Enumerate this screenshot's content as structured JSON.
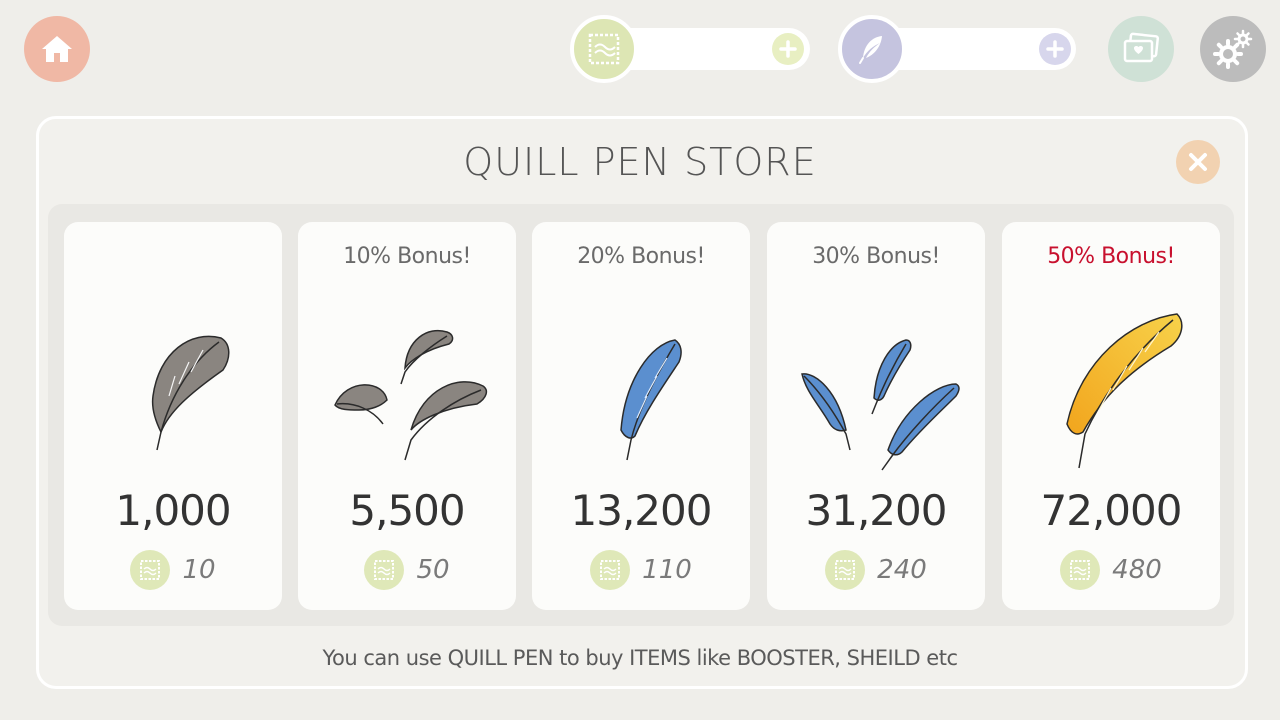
{
  "hud": {
    "home_icon": "home-icon",
    "stamp_currency": {
      "icon": "stamp-icon",
      "color": "#dde6b4",
      "value": ""
    },
    "quill_currency": {
      "icon": "quill-icon",
      "color": "#c5c4df",
      "value": ""
    },
    "album_icon": "photo-album-icon",
    "settings_icon": "gear-icon"
  },
  "store": {
    "title": "QUILL PEN STORE",
    "close_icon": "close-icon",
    "footer_note": "You can use QUILL PEN to buy  ITEMS like BOOSTER, SHEILD etc",
    "packs": [
      {
        "bonus": "",
        "highlight": false,
        "feather_color": "gray",
        "feather_count": 1,
        "amount": "1,000",
        "price": "10",
        "price_icon": "stamp-icon"
      },
      {
        "bonus": "10% Bonus!",
        "highlight": false,
        "feather_color": "gray",
        "feather_count": 3,
        "amount": "5,500",
        "price": "50",
        "price_icon": "stamp-icon"
      },
      {
        "bonus": "20% Bonus!",
        "highlight": false,
        "feather_color": "blue",
        "feather_count": 1,
        "amount": "13,200",
        "price": "110",
        "price_icon": "stamp-icon"
      },
      {
        "bonus": "30% Bonus!",
        "highlight": false,
        "feather_color": "blue",
        "feather_count": 3,
        "amount": "31,200",
        "price": "240",
        "price_icon": "stamp-icon"
      },
      {
        "bonus": "50% Bonus!",
        "highlight": true,
        "feather_color": "gold",
        "feather_count": 1,
        "amount": "72,000",
        "price": "480",
        "price_icon": "stamp-icon"
      }
    ]
  },
  "colors": {
    "background": "#efeeea",
    "bonus_highlight": "#c8102e",
    "home_button": "#f0b8a5",
    "close_button": "#f2d2b1"
  }
}
